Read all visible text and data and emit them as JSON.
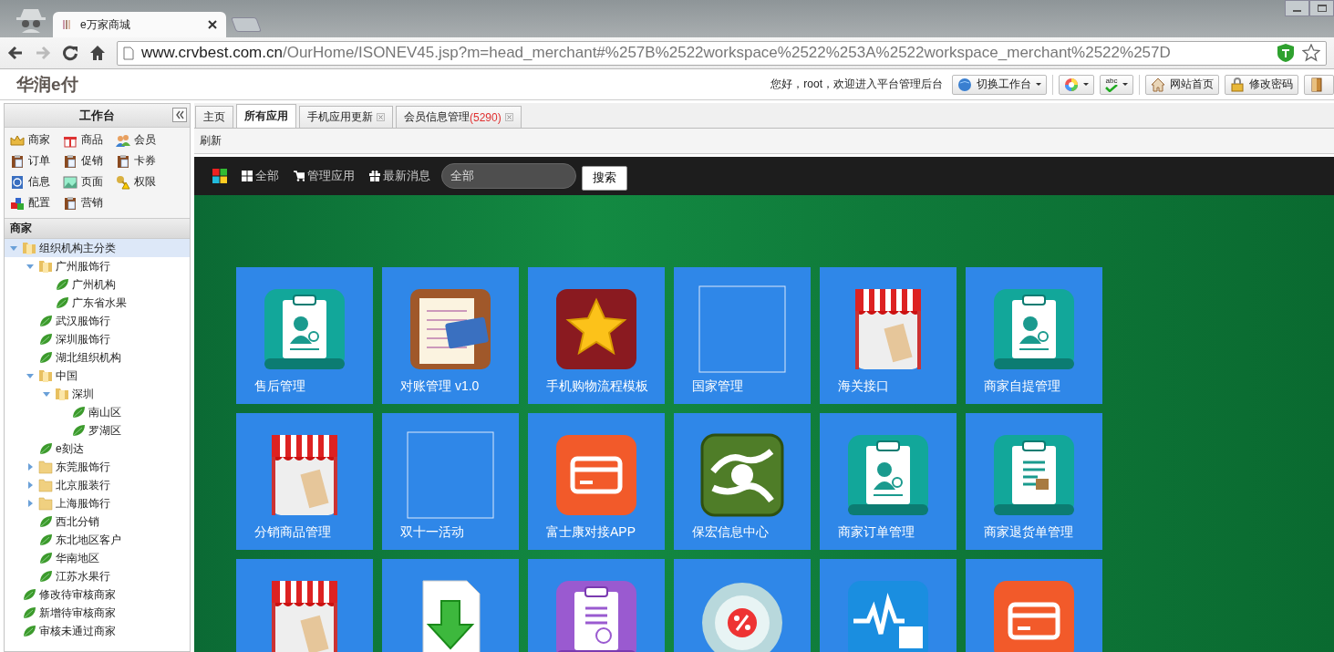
{
  "browser": {
    "tab": {
      "title": "e万家商城"
    },
    "url": {
      "host": "www.crvbest.com.cn",
      "path": "/OurHome/ISONEV45.jsp?m=head_merchant#%257B%2522workspace%2522%253A%2522workspace_merchant%2522%257D"
    },
    "forward_disabled": true
  },
  "header": {
    "logo": "华润e付",
    "greeting": "您好，root，欢迎进入平台管理后台",
    "switch_button": "切换工作台",
    "spell_label": "abc",
    "links": [
      {
        "label": "网站首页",
        "kind": "home"
      },
      {
        "label": "修改密码",
        "kind": "lock"
      },
      {
        "kind": "door"
      }
    ]
  },
  "sidebar": {
    "title": "工作台",
    "launcher": [
      {
        "label": "商家",
        "kind": "crown"
      },
      {
        "label": "商品",
        "kind": "gift"
      },
      {
        "label": "会员",
        "kind": "people"
      },
      {
        "label": "订单",
        "kind": "clipboard"
      },
      {
        "label": "促销",
        "kind": "clipboard"
      },
      {
        "label": "卡券",
        "kind": "clipboard"
      },
      {
        "label": "信息",
        "kind": "contact"
      },
      {
        "label": "页面",
        "kind": "picture"
      },
      {
        "label": "权限",
        "kind": "key"
      },
      {
        "label": "配置",
        "kind": "blocks"
      },
      {
        "label": "营销",
        "kind": "clipboard"
      }
    ],
    "tree_title": "商家",
    "tree": [
      {
        "label": "组织机构主分类",
        "selected": true,
        "expanded": true,
        "children": [
          {
            "label": "广州服饰行",
            "selected": false,
            "expanded": true,
            "children": [
              {
                "label": "广州机构",
                "selected": false
              },
              {
                "label": "广东省水果",
                "selected": false
              }
            ]
          },
          {
            "label": "武汉服饰行",
            "selected": false
          },
          {
            "label": "深圳服饰行",
            "selected": false
          },
          {
            "label": "湖北组织机构",
            "selected": false
          },
          {
            "label": "中国",
            "selected": false,
            "expanded": true,
            "children": [
              {
                "label": "深圳",
                "selected": false,
                "expanded": true,
                "children": [
                  {
                    "label": "南山区",
                    "selected": false
                  },
                  {
                    "label": "罗湖区",
                    "selected": false
                  }
                ]
              }
            ]
          },
          {
            "label": "e刻达",
            "selected": false
          },
          {
            "label": "东莞服饰行",
            "selected": false,
            "expanded": false
          },
          {
            "label": "北京服装行",
            "selected": false,
            "expanded": false
          },
          {
            "label": "上海服饰行",
            "selected": false,
            "expanded": false
          },
          {
            "label": "西北分销",
            "selected": false
          },
          {
            "label": "东北地区客户",
            "selected": false
          },
          {
            "label": "华南地区",
            "selected": false
          },
          {
            "label": "江苏水果行",
            "selected": false
          }
        ]
      },
      {
        "label": "修改待审核商家",
        "selected": false
      },
      {
        "label": "新增待审核商家",
        "selected": false
      },
      {
        "label": "审核未通过商家",
        "selected": false
      }
    ]
  },
  "tabs": [
    {
      "label": "主页",
      "selected": false,
      "closable": false
    },
    {
      "label": "所有应用",
      "selected": true,
      "closable": false
    },
    {
      "label": "手机应用更新",
      "selected": false,
      "closable": true
    },
    {
      "label": "会员信息管理",
      "count": "(5290)",
      "selected": false,
      "closable": true
    }
  ],
  "toolbar": {
    "refresh": "刷新"
  },
  "app_bar": {
    "menu": [
      {
        "label": "全部",
        "kind": "grid"
      },
      {
        "label": "管理应用",
        "kind": "cart"
      },
      {
        "label": "最新消息",
        "kind": "gift"
      }
    ],
    "search_value": "全部",
    "search_button": "搜索"
  },
  "apps": [
    {
      "label": "售后管理",
      "kind": "clipboard-person"
    },
    {
      "label": "对账管理 v1.0",
      "kind": "ledger"
    },
    {
      "label": "手机购物流程模板",
      "kind": "star"
    },
    {
      "label": "国家管理",
      "kind": "empty"
    },
    {
      "label": "海关接口",
      "kind": "sale"
    },
    {
      "label": "商家自提管理",
      "kind": "clipboard-person"
    },
    {
      "label": "分销商品管理",
      "kind": "sale"
    },
    {
      "label": "双十一活动",
      "kind": "empty"
    },
    {
      "label": "富士康对接APP",
      "kind": "card"
    },
    {
      "label": "保宏信息中心",
      "kind": "sync"
    },
    {
      "label": "商家订单管理",
      "kind": "clipboard-person"
    },
    {
      "label": "商家退货单管理",
      "kind": "clipboard-box"
    },
    {
      "kind": "sale"
    },
    {
      "kind": "download"
    },
    {
      "kind": "clipboard-purple"
    },
    {
      "kind": "percent"
    },
    {
      "kind": "pulse"
    },
    {
      "kind": "card"
    }
  ]
}
